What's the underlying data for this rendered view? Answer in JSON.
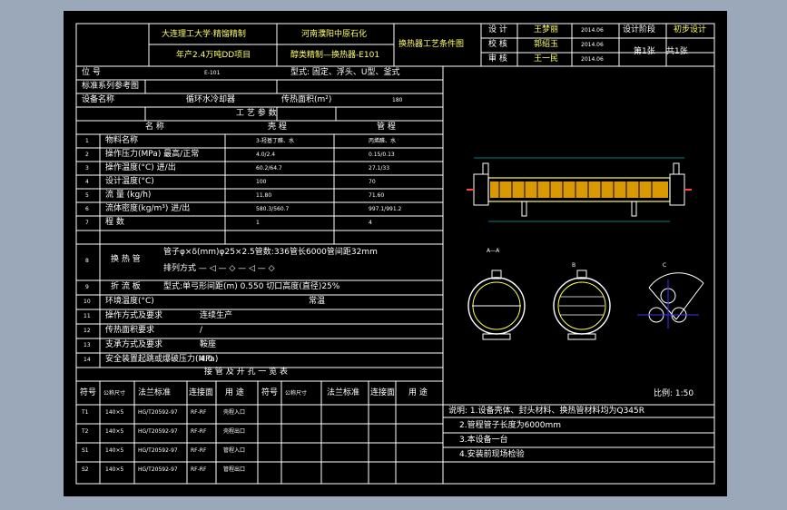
{
  "title_block": {
    "org1": "大连理工大学·精馏精制",
    "org2": "年产2.4万吨DD项目",
    "client1": "河南濮阳中原石化",
    "client2": "醇类精制—换热器-E101",
    "drawing_name": "换热器工艺条件图",
    "role1": "设 计",
    "name1": "王梦丽",
    "date1": "2014.06",
    "role2": "校 核",
    "name2": "郭绍玉",
    "date2": "2014.06",
    "role3": "审 核",
    "name3": "王一民",
    "date3": "2014.06",
    "stage_label": "设计阶段",
    "stage_value": "初步设计",
    "sheet_label": "第1张",
    "sheet_total": "共1张"
  },
  "header_rows": {
    "tag_label": "位 号",
    "tag_value": "E-101",
    "type_text": "型式: 固定、浮头、U型、釜式",
    "std_label": "标准系列参考图",
    "std_value": "",
    "name_label": "设备名称",
    "name_value": "循环水冷却器",
    "area_label": "传热面积(m²)",
    "area_value": "180"
  },
  "process_table": {
    "title": "工 艺 参 数",
    "col_name": "名 称",
    "col_shell": "壳 程",
    "col_tube": "管 程",
    "rows": [
      {
        "n": "1",
        "name": "物料名称",
        "shell": "3-羟基丁醛、水",
        "tube": "丙烯醛、水"
      },
      {
        "n": "2",
        "name": "操作压力(MPa) 最高/正常",
        "shell": "4.0/2.4",
        "tube": "0.15/0.13"
      },
      {
        "n": "3",
        "name": "操作温度(°C) 进/出",
        "shell": "60.2/64.7",
        "tube": "27.1/33"
      },
      {
        "n": "4",
        "name": "设计温度(°C)",
        "shell": "100",
        "tube": "70"
      },
      {
        "n": "5",
        "name": "流 量 (kg/h)",
        "shell": "11.80",
        "tube": "71.60"
      },
      {
        "n": "6",
        "name": "流体密度(kg/m³) 进/出",
        "shell": "580.3/560.7",
        "tube": "997.1/991.2"
      },
      {
        "n": "7",
        "name": "程 数",
        "shell": "1",
        "tube": "4"
      }
    ],
    "row8_name": "换 热 管",
    "row8_line1": "管子φ×δ(mm)φ25×2.5管数:336管长6000管间距32mm",
    "row8_line2": "排列方式 — ◁ — ◇ — ◁ — ◇",
    "row9_name": "折 流 板",
    "row9_text": "型式:单弓形间距(m) 0.550 切口高度(直径)25%",
    "rows_tail": [
      {
        "n": "10",
        "name": "环境温度(°C)",
        "value": "常温"
      },
      {
        "n": "11",
        "name": "操作方式及要求",
        "value": "连续生产"
      },
      {
        "n": "12",
        "name": "传热面积要求",
        "value": "/"
      },
      {
        "n": "13",
        "name": "支承方式及要求",
        "value": "鞍座"
      },
      {
        "n": "14",
        "name": "安全装置起跳或爆破压力(MPa)",
        "value": "4.0"
      }
    ]
  },
  "nozzle_table": {
    "title": "接 管 及 开 孔 一 览 表",
    "h_no": "符号",
    "h_dn": "公称尺寸",
    "h_std": "法兰标准",
    "h_face": "连接面",
    "h_use": "用 途",
    "h_no2": "符号",
    "h_dn2": "公称尺寸",
    "h_std2": "法兰标准",
    "h_face2": "连接面",
    "h_use2": "用 途",
    "rows": [
      {
        "no": "T1",
        "dn": "140×5",
        "std": "HG/T20592-97",
        "face": "RF-RF",
        "use": "壳程入口"
      },
      {
        "no": "T2",
        "dn": "140×5",
        "std": "HG/T20592-97",
        "face": "RF-RF",
        "use": "壳程出口"
      },
      {
        "no": "S1",
        "dn": "140×5",
        "std": "HG/T20592-97",
        "face": "RF-RF",
        "use": "管程入口"
      },
      {
        "no": "S2",
        "dn": "140×5",
        "std": "HG/T20592-97",
        "face": "RF-RF",
        "use": "管程出口"
      }
    ]
  },
  "notes": [
    "说明: 1.设备壳体、封头材料、换热管材料均为Q345R",
    "2.管程管子长度为6000mm",
    "3.本设备一台",
    "4.安装前现场检验"
  ],
  "scale_text": "比例: 1:50",
  "view_labels": {
    "a": "A—A",
    "b": "B",
    "c": "C"
  },
  "colors": {
    "frame": "#ffffff",
    "vessel": "#ffff55",
    "dim": "#00ffff",
    "nozzle": "#ff4444",
    "blue": "#3333ff"
  }
}
